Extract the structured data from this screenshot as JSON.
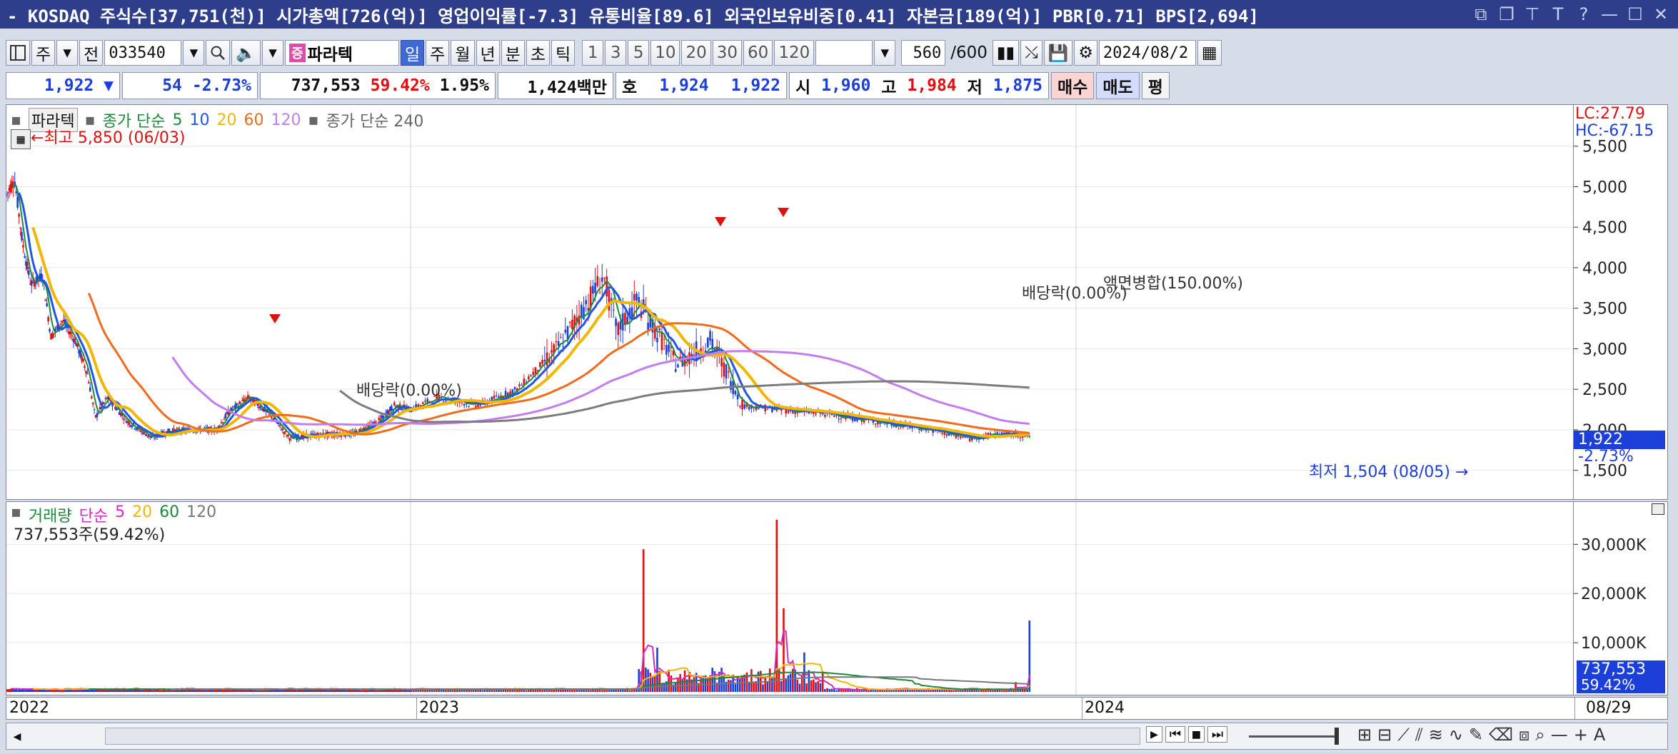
{
  "titlebar": {
    "text": "- KOSDAQ 주식수[37,751(천)] 시가총액[726(억)] 영업이익률[-7.3] 유통비율[89.6] 외국인보유비중[0.41] 자본금[189(억)] PBR[0.71] BPS[2,694]",
    "controls": [
      "⧉",
      "❐",
      "⊤",
      "T",
      "?",
      "—",
      "☐",
      "✕"
    ]
  },
  "toolbar": {
    "market": "주",
    "all": "전",
    "code": "033540",
    "badge": "증",
    "stock_name": "파라텍",
    "periods": [
      "일",
      "주",
      "월",
      "년",
      "분",
      "초",
      "틱"
    ],
    "selected_period": "일",
    "intervals": [
      "1",
      "3",
      "5",
      "10",
      "20",
      "30",
      "60",
      "120"
    ],
    "count_display": "560",
    "count_total": "/600",
    "date": "2024/08/2"
  },
  "quote": {
    "price": "1,922",
    "arrow": "▼",
    "change": "54",
    "change_pct": "-2.73%",
    "volume": "737,553",
    "vol_ratio": "59.42%",
    "turnover": "1.95%",
    "amount": "1,424백만",
    "ho_label": "호",
    "ask": "1,924",
    "bid": "1,922",
    "open_label": "시",
    "open": "1,960",
    "high_label": "고",
    "high": "1,984",
    "low_label": "저",
    "low": "1,875",
    "buy": "매수",
    "sell": "매도",
    "pyeong": "평"
  },
  "price_legend": {
    "name": "파라텍",
    "ma_label": "종가 단순",
    "ma_periods": [
      "5",
      "10",
      "20",
      "60",
      "120"
    ],
    "ma_colors": [
      "#1d8a3a",
      "#2156e0",
      "#f2b705",
      "#f26a1b",
      "#c27ef0"
    ],
    "ma240_label": "종가 단순 240",
    "ma240_color": "#7c7c7c"
  },
  "annotations": {
    "high": "최고 5,850 (06/03)",
    "low": "최저 1,504 (08/05)",
    "div1": "배당락(0.00%)",
    "div2": "배당락(0.00%)",
    "merge": "액면병합(150.00%)"
  },
  "price_axis": {
    "lc": "LC:27.79",
    "hc": "HC:-67.15",
    "current_price": "1,922",
    "current_pct": "-2.73%"
  },
  "volume_legend": {
    "label": "거래량",
    "ma_label": "단순",
    "ma_periods": [
      "5",
      "20",
      "60",
      "120"
    ],
    "ma_colors": [
      "#d62ac4",
      "#f2b705",
      "#1d8a3a",
      "#777777"
    ],
    "summary": "737,553주(59.42%)"
  },
  "volume_axis": {
    "current": "737,553",
    "current_pct": "59.42%"
  },
  "date_axis": {
    "labels": [
      "2022",
      "2023",
      "2024"
    ],
    "last_date": "08/29"
  },
  "scroll_controls": [
    "▶",
    "⏮",
    "■",
    "⏭"
  ],
  "colors": {
    "up": "#e01010",
    "down": "#1c3fd8",
    "title_bg": "#2f3e8a"
  },
  "chart_data": {
    "type": "candlestick",
    "title": "",
    "x_range": [
      "2022-01",
      "2024-08-29"
    ],
    "price_ylim": [
      1250,
      5850
    ],
    "price_ticks": [
      1500,
      2000,
      2500,
      3000,
      3500,
      4000,
      4500,
      5000,
      5500
    ],
    "price_tick_labels": [
      "1,500",
      "2,000",
      "2,500",
      "3,000",
      "3,500",
      "4,000",
      "4,500",
      "5,000",
      "5,500"
    ],
    "volume_ylim": [
      0,
      36000
    ],
    "volume_ticks": [
      10000,
      20000,
      30000
    ],
    "volume_tick_labels": [
      "10,000K",
      "20,000K",
      "30,000K"
    ],
    "close_path": [
      {
        "t": 0.0,
        "v": 4900
      },
      {
        "t": 0.02,
        "v": 5100
      },
      {
        "t": 0.04,
        "v": 4300
      },
      {
        "t": 0.06,
        "v": 3800
      },
      {
        "t": 0.09,
        "v": 3900
      },
      {
        "t": 0.11,
        "v": 3150
      },
      {
        "t": 0.14,
        "v": 3350
      },
      {
        "t": 0.17,
        "v": 3100
      },
      {
        "t": 0.2,
        "v": 2700
      },
      {
        "t": 0.22,
        "v": 2150
      },
      {
        "t": 0.25,
        "v": 2400
      },
      {
        "t": 0.3,
        "v": 2100
      },
      {
        "t": 0.36,
        "v": 1900
      },
      {
        "t": 0.4,
        "v": 1980
      },
      {
        "t": 0.46,
        "v": 2000
      },
      {
        "t": 0.52,
        "v": 2000
      },
      {
        "t": 0.55,
        "v": 2220
      },
      {
        "t": 0.6,
        "v": 2400
      },
      {
        "t": 0.65,
        "v": 2200
      },
      {
        "t": 0.7,
        "v": 1900
      },
      {
        "t": 0.78,
        "v": 1940
      },
      {
        "t": 0.86,
        "v": 1950
      },
      {
        "t": 0.92,
        "v": 2100
      },
      {
        "t": 0.96,
        "v": 2300
      },
      {
        "t": 1.0,
        "v": 2250
      },
      {
        "t": 1.04,
        "v": 2400
      },
      {
        "t": 1.1,
        "v": 2300
      },
      {
        "t": 1.16,
        "v": 2500
      },
      {
        "t": 1.22,
        "v": 3000
      },
      {
        "t": 1.26,
        "v": 3500
      },
      {
        "t": 1.29,
        "v": 3900
      },
      {
        "t": 1.31,
        "v": 3200
      },
      {
        "t": 1.34,
        "v": 3600
      },
      {
        "t": 1.4,
        "v": 2800
      },
      {
        "t": 1.45,
        "v": 3100
      },
      {
        "t": 1.5,
        "v": 2300
      },
      {
        "t": 1.55,
        "v": 2250
      },
      {
        "t": 1.62,
        "v": 2200
      },
      {
        "t": 1.7,
        "v": 2100
      },
      {
        "t": 1.78,
        "v": 2000
      },
      {
        "t": 1.84,
        "v": 1890
      },
      {
        "t": 1.88,
        "v": 1950
      },
      {
        "t": 1.93,
        "v": 1922
      }
    ],
    "volume_spikes": [
      {
        "t": 1.35,
        "v": 29000
      },
      {
        "t": 1.37,
        "v": 9000
      },
      {
        "t": 1.55,
        "v": 35000
      },
      {
        "t": 1.56,
        "v": 17000
      },
      {
        "t": 1.59,
        "v": 8000
      },
      {
        "t": 1.91,
        "v": 2000
      },
      {
        "t": 1.93,
        "v": 14500
      },
      {
        "t": 1.94,
        "v": 5000
      }
    ]
  }
}
